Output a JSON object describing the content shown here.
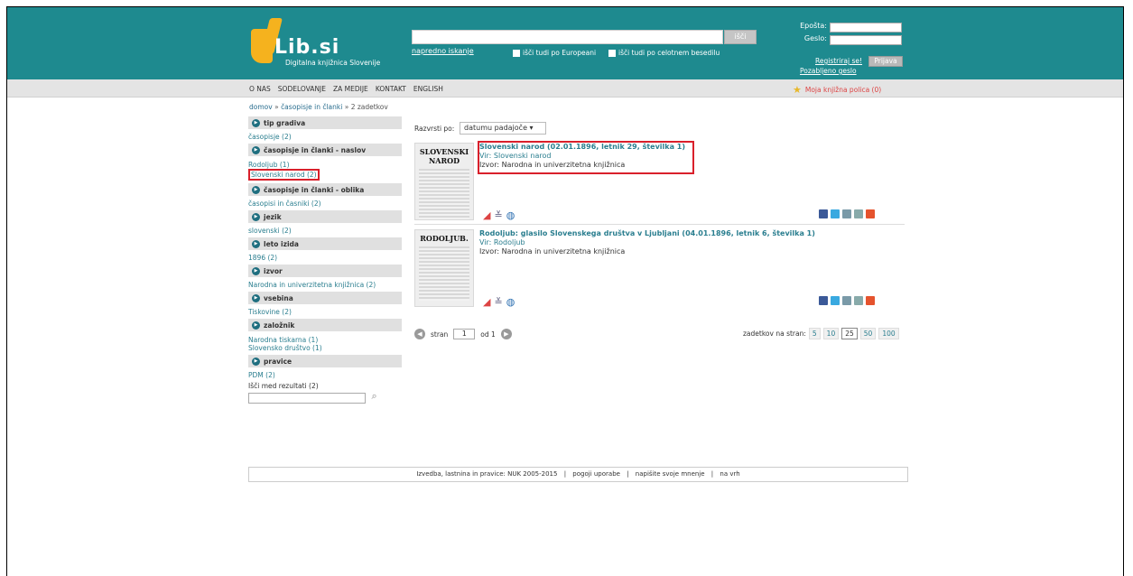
{
  "header": {
    "logo_text": "Lib.si",
    "logo_sub": "Digitalna knjižnica Slovenije",
    "search_button": "išči",
    "advanced_search": "napredno iskanje",
    "check_europeana": "išči tudi po Europeani",
    "check_fulltext": "išči tudi po celotnem besedilu",
    "email_label": "Epošta:",
    "password_label": "Geslo:",
    "register_link": "Registriraj se!",
    "forgot_link": "Pozabljeno geslo",
    "login_button": "Prijava"
  },
  "nav": {
    "items": [
      "O NAS",
      "SODELOVANJE",
      "ZA MEDIJE",
      "KONTAKT",
      "ENGLISH"
    ],
    "shelf": "Moja knjižna polica (0)"
  },
  "breadcrumb": {
    "home": "domov",
    "section": "časopisje in članki",
    "count": "2 zadetkov"
  },
  "sidebar": {
    "facets": [
      {
        "heading": "tip gradiva",
        "values": [
          "časopisje (2)"
        ]
      },
      {
        "heading": "časopisje in članki - naslov",
        "values": [
          "Rodoljub (1)",
          "Slovenski narod (2)"
        ]
      },
      {
        "heading": "časopisje in članki - oblika",
        "values": [
          "časopisi in časniki (2)"
        ]
      },
      {
        "heading": "jezik",
        "values": [
          "slovenski (2)"
        ]
      },
      {
        "heading": "leto izida",
        "values": [
          "1896 (2)"
        ]
      },
      {
        "heading": "izvor",
        "values": [
          "Narodna in univerzitetna knjižnica (2)"
        ]
      },
      {
        "heading": "vsebina",
        "values": [
          "Tiskovine (2)"
        ]
      },
      {
        "heading": "založnik",
        "values": [
          "Narodna tiskarna (1)",
          "Slovensko društvo (1)"
        ]
      },
      {
        "heading": "pravice",
        "values": [
          "PDM (2)"
        ]
      }
    ],
    "search_label": "Išči med rezultati (2)"
  },
  "results": {
    "sort_label": "Razvrsti po:",
    "sort_value": "datumu padajoče ▾",
    "items": [
      {
        "thumb_title": "SLOVENSKI NAROD",
        "title": "Slovenski narod (02.01.1896, letnik 29, številka 1)",
        "vir": "Vir: Slovenski narod",
        "izvor": "Izvor: Narodna in univerzitetna knjižnica"
      },
      {
        "thumb_title": "RODOLJUB.",
        "title": "Rodoljub: glasilo Slovenskega društva v Ljubljani (04.01.1896, letnik 6, številka 1)",
        "vir": "Vir: Rodoljub",
        "izvor": "Izvor: Narodna in univerzitetna knjižnica"
      }
    ]
  },
  "pager": {
    "page_label": "stran",
    "page_value": "1",
    "of_label": "od 1",
    "per_page_label": "zadetkov na stran:",
    "per_page_options": [
      "5",
      "10",
      "25",
      "50",
      "100"
    ],
    "per_page_selected": "25"
  },
  "footer": {
    "credit": "Izvedba, lastnina in pravice: NUK 2005-2015",
    "terms": "pogoji uporabe",
    "feedback": "napišite svoje mnenje",
    "top": "na vrh"
  },
  "colors": {
    "header_bg": "#1e8a8f",
    "link": "#2a7e8f",
    "highlight": "#d9202b",
    "logo": "#f5b21e"
  }
}
